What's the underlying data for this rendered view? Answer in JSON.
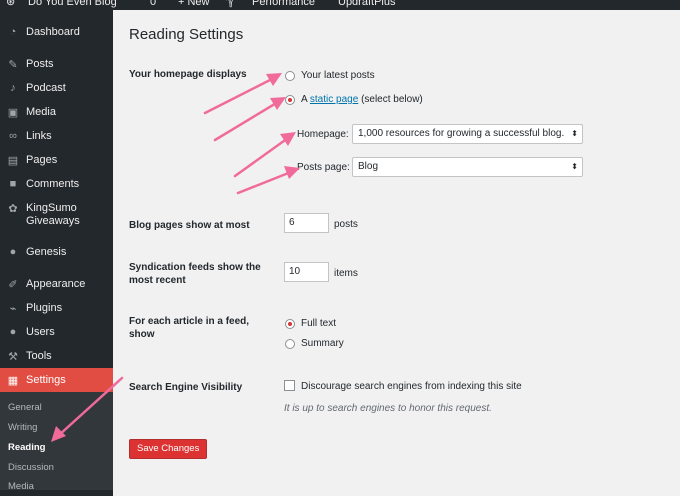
{
  "adminbar": {
    "items": [
      "Do You Even Blog",
      "0",
      "+ New",
      "Performance",
      "UpdraftPlus"
    ]
  },
  "sidebar": {
    "items": [
      {
        "label": "Dashboard",
        "icon": "dashboard-icon"
      },
      {
        "label": "Posts",
        "icon": "pin-icon"
      },
      {
        "label": "Podcast",
        "icon": "microphone-icon"
      },
      {
        "label": "Media",
        "icon": "media-icon"
      },
      {
        "label": "Links",
        "icon": "link-icon"
      },
      {
        "label": "Pages",
        "icon": "pages-icon"
      },
      {
        "label": "Comments",
        "icon": "comment-icon"
      },
      {
        "label": "KingSumo Giveaways",
        "icon": "kingsumo-icon"
      },
      {
        "label": "Genesis",
        "icon": "genesis-icon"
      },
      {
        "label": "Appearance",
        "icon": "brush-icon"
      },
      {
        "label": "Plugins",
        "icon": "plug-icon"
      },
      {
        "label": "Users",
        "icon": "user-icon"
      },
      {
        "label": "Tools",
        "icon": "wrench-icon"
      },
      {
        "label": "Settings",
        "icon": "settings-icon"
      }
    ],
    "submenu": [
      "General",
      "Writing",
      "Reading",
      "Discussion",
      "Media"
    ]
  },
  "page": {
    "title": "Reading Settings",
    "homepage_displays": {
      "label": "Your homepage displays",
      "option_latest": "Your latest posts",
      "option_static_prefix": "A",
      "option_static_link": "static page",
      "option_static_suffix": "(select below)",
      "homepage_label": "Homepage:",
      "homepage_value": "1,000 resources for growing a successful blog.",
      "posts_page_label": "Posts page:",
      "posts_page_value": "Blog"
    },
    "blog_pages": {
      "label": "Blog pages show at most",
      "value": "6",
      "unit": "posts"
    },
    "syndication": {
      "label": "Syndication feeds show the most recent",
      "value": "10",
      "unit": "items"
    },
    "feed_article": {
      "label": "For each article in a feed, show",
      "option_full": "Full text",
      "option_summary": "Summary"
    },
    "search_visibility": {
      "label": "Search Engine Visibility",
      "checkbox_label": "Discourage search engines from indexing this site",
      "description": "It is up to search engines to honor this request."
    },
    "save_label": "Save Changes"
  },
  "colors": {
    "sidebar_bg": "#23282d",
    "active_menu": "#e14d43",
    "annotation_arrow": "#f06b9a",
    "link": "#0073aa"
  }
}
